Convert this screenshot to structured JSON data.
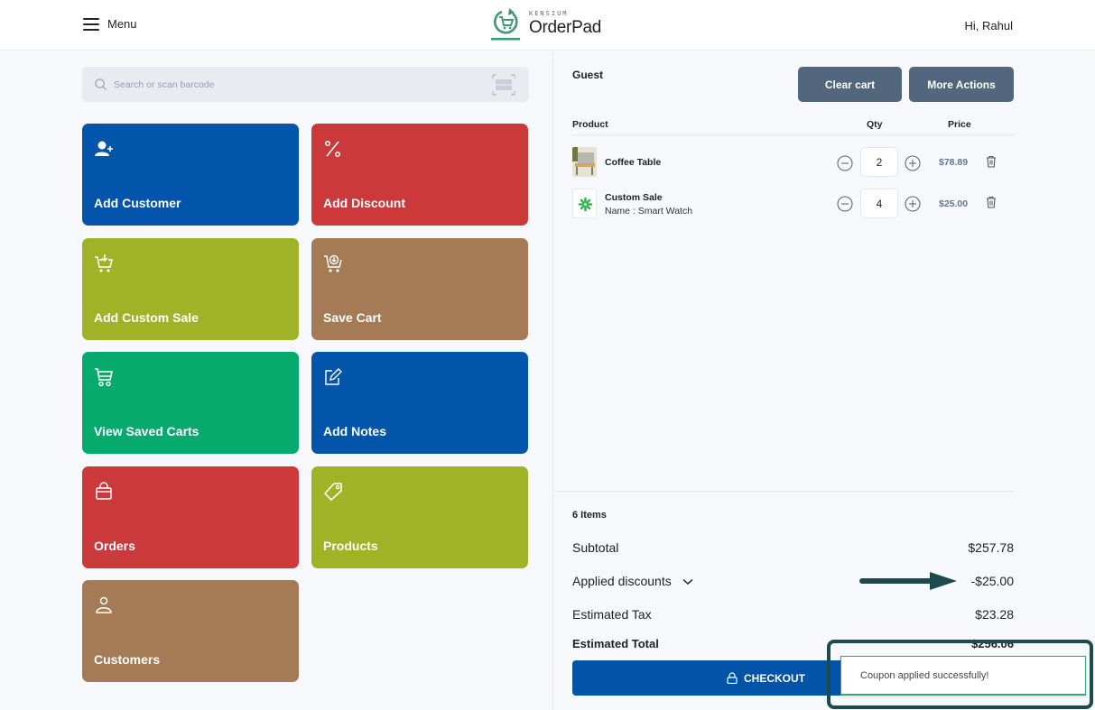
{
  "header": {
    "menu_label": "Menu",
    "brand_small": "KENSIUM",
    "brand_name": "OrderPad",
    "greeting": "Hi, Rahul"
  },
  "search": {
    "placeholder": "Search or scan barcode",
    "value": ""
  },
  "tiles": [
    {
      "label": "Add Customer",
      "icon": "add-user-icon",
      "color": "#0255ab"
    },
    {
      "label": "Add Discount",
      "icon": "percent-icon",
      "color": "#cb393b"
    },
    {
      "label": "Add Custom Sale",
      "icon": "cart-download-icon",
      "color": "#a0b226"
    },
    {
      "label": "Save Cart",
      "icon": "cart-save-icon",
      "color": "#a57b56"
    },
    {
      "label": "View Saved Carts",
      "icon": "cart-icon",
      "color": "#05aa6c"
    },
    {
      "label": "Add Notes",
      "icon": "edit-note-icon",
      "color": "#0255ab"
    },
    {
      "label": "Orders",
      "icon": "shopping-bag-icon",
      "color": "#cb393b"
    },
    {
      "label": "Products",
      "icon": "tag-icon",
      "color": "#a0b226"
    },
    {
      "label": "Customers",
      "icon": "user-icon",
      "color": "#a57b56"
    }
  ],
  "cart": {
    "customer": "Guest",
    "clear_label": "Clear cart",
    "more_label": "More Actions",
    "columns": {
      "product": "Product",
      "qty": "Qty",
      "price": "Price"
    },
    "items": [
      {
        "name": "Coffee Table",
        "subtitle": "",
        "qty": "2",
        "price": "$78.89",
        "thumb": "coffee-table-image"
      },
      {
        "name": "Custom Sale",
        "subtitle": "Name : Smart Watch",
        "qty": "4",
        "price": "$25.00",
        "thumb": "custom-sale-logo"
      }
    ]
  },
  "summary": {
    "items_count": "6 Items",
    "subtotal_label": "Subtotal",
    "subtotal": "$257.78",
    "discount_label": "Applied discounts",
    "discount": "-$25.00",
    "tax_label": "Estimated Tax",
    "tax": "$23.28",
    "total_label": "Estimated Total",
    "total": "$256.06",
    "checkout_label": "CHECKOUT"
  },
  "toast": {
    "message": "Coupon applied successfully!"
  },
  "colors": {
    "primary": "#0353a8",
    "slate_button": "#52667e",
    "annotation": "#1d4a4e",
    "toast_border": "#3aa77a"
  }
}
